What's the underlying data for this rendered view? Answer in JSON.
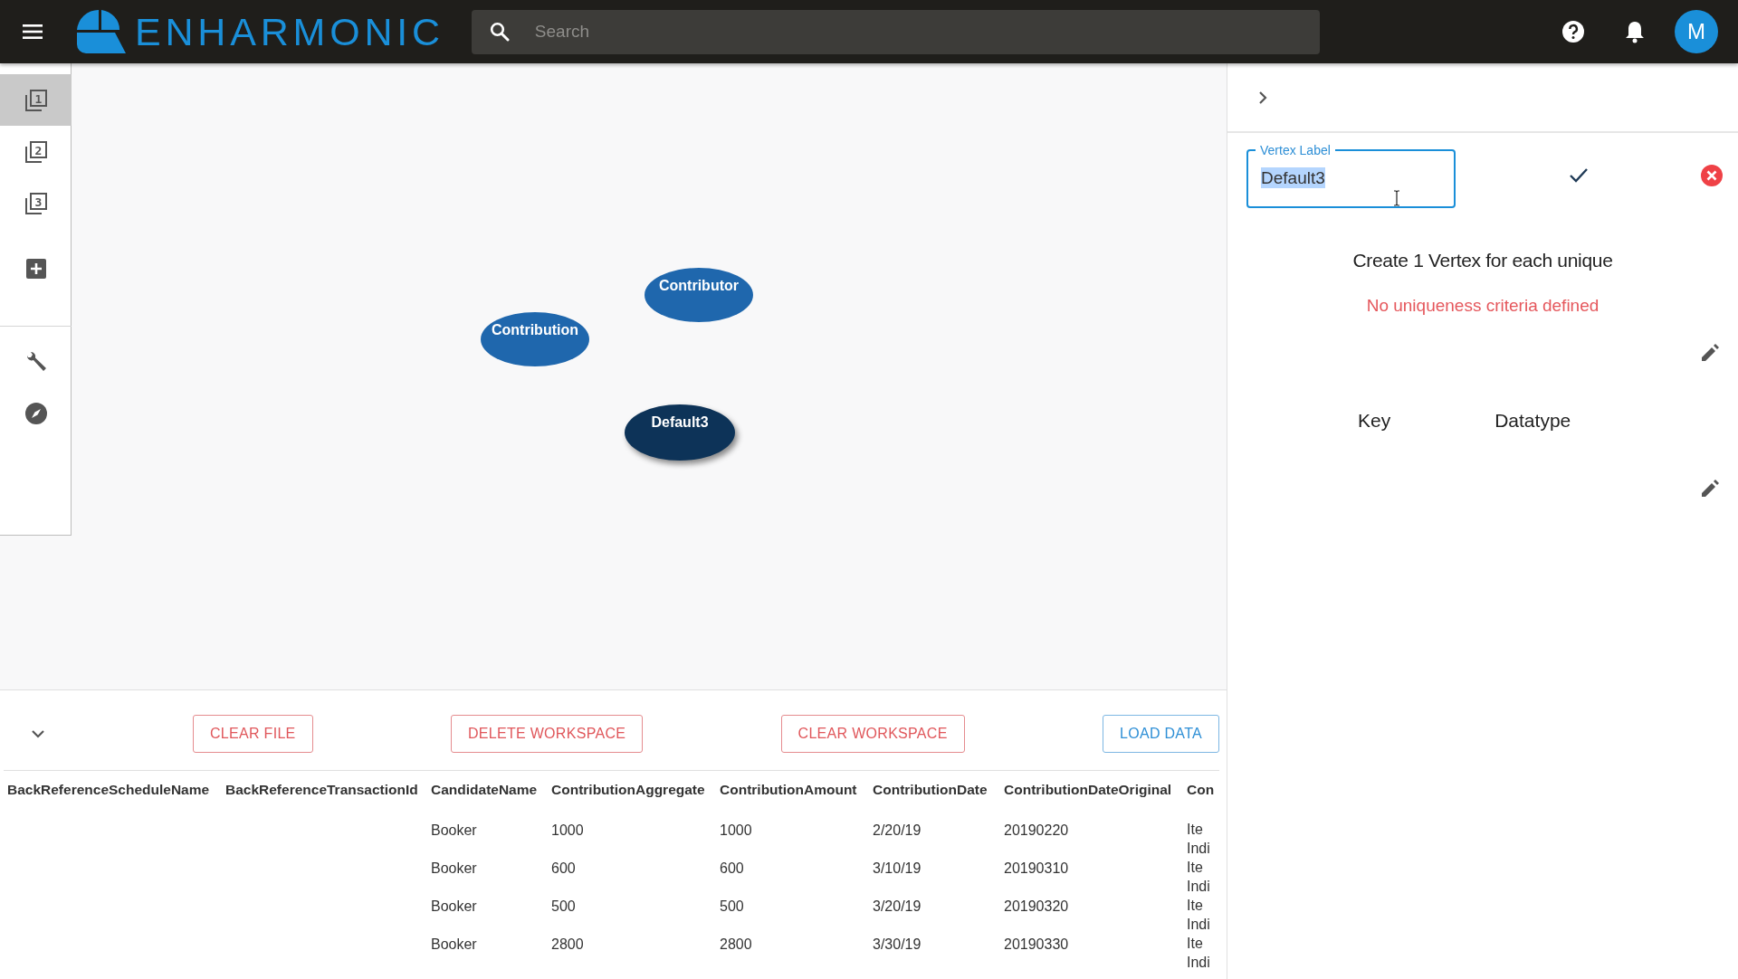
{
  "top_bar": {
    "logo_text": "ENHARMONIC",
    "search": {
      "placeholder": "Search"
    },
    "avatar": "M"
  },
  "sidebar": {
    "items": [
      {
        "kind": "page",
        "label": "1",
        "selected": true
      },
      {
        "kind": "page",
        "label": "2",
        "selected": false
      },
      {
        "kind": "page",
        "label": "3",
        "selected": false
      },
      {
        "kind": "add",
        "selected": false
      },
      {
        "kind": "tools",
        "selected": false
      },
      {
        "kind": "explore",
        "selected": false
      }
    ]
  },
  "graph": {
    "nodes": [
      {
        "label": "Contribution",
        "selected": false
      },
      {
        "label": "Contributor",
        "selected": false
      },
      {
        "label": "Default3",
        "selected": true
      }
    ]
  },
  "panel": {
    "vertex_label": {
      "label": "Vertex Label",
      "value": "Default3"
    },
    "heading": "Create 1 Vertex for each unique",
    "warning": "No uniqueness criteria defined",
    "columns": [
      "Key",
      "Datatype"
    ]
  },
  "actions": {
    "buttons": [
      {
        "label": "CLEAR FILE",
        "kind": "danger"
      },
      {
        "label": "DELETE WORKSPACE",
        "kind": "danger"
      },
      {
        "label": "CLEAR WORKSPACE",
        "kind": "danger"
      },
      {
        "label": "LOAD DATA",
        "kind": "primary"
      }
    ]
  },
  "table": {
    "columns": [
      "BackReferenceScheduleName",
      "BackReferenceTransactionId",
      "CandidateName",
      "ContributionAggregate",
      "ContributionAmount",
      "ContributionDate",
      "ContributionDateOriginal",
      "Con"
    ],
    "rows": [
      [
        null,
        null,
        "Booker",
        "1000",
        "1000",
        "2/20/19",
        "20190220",
        "Ite\nIndi"
      ],
      [
        null,
        null,
        "Booker",
        "600",
        "600",
        "3/10/19",
        "20190310",
        "Ite\nIndi"
      ],
      [
        null,
        null,
        "Booker",
        "500",
        "500",
        "3/20/19",
        "20190320",
        "Ite\nIndi"
      ],
      [
        null,
        null,
        "Booker",
        "2800",
        "2800",
        "3/30/19",
        "20190330",
        "Ite\nIndi"
      ]
    ]
  }
}
